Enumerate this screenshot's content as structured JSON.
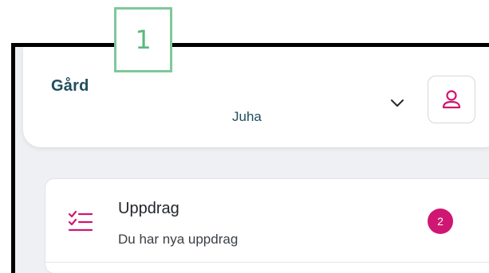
{
  "header": {
    "farm_label": "Gård",
    "farm_name": "Juha"
  },
  "task": {
    "title": "Uppdrag",
    "subtitle": "Du har nya uppdrag",
    "badge_count": "2",
    "icon": "task-list-icon"
  },
  "step_marker": {
    "label": "1"
  },
  "icons": {
    "dropdown": "chevron-down-icon",
    "profile": "user-icon"
  },
  "colors": {
    "brand_text": "#1f4d5c",
    "accent": "#cf1672",
    "marker": "#7fc89a"
  }
}
